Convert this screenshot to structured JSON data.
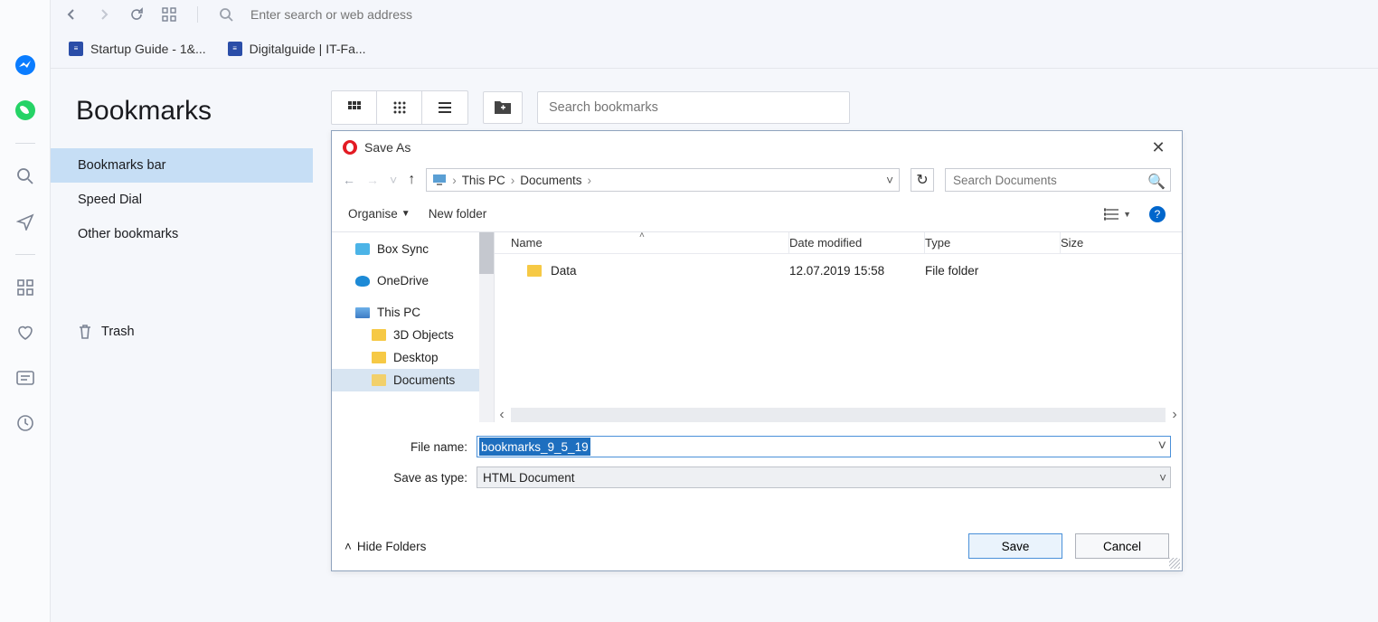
{
  "topbar": {
    "search_placeholder": "Enter search or web address"
  },
  "tabs": [
    {
      "label": "Startup Guide - 1&..."
    },
    {
      "label": "Digitalguide | IT-Fa..."
    }
  ],
  "page_title": "Bookmarks",
  "sidebar": {
    "items": [
      "Bookmarks bar",
      "Speed Dial",
      "Other bookmarks"
    ],
    "trash": "Trash"
  },
  "search_bookmarks_placeholder": "Search bookmarks",
  "modal": {
    "title": "Save As",
    "crumbs": [
      "This PC",
      "Documents"
    ],
    "search_placeholder": "Search Documents",
    "organise": "Organise",
    "new_folder": "New folder",
    "columns": {
      "name": "Name",
      "date": "Date modified",
      "type": "Type",
      "size": "Size"
    },
    "rows": [
      {
        "name": "Data",
        "date": "12.07.2019 15:58",
        "type": "File folder"
      }
    ],
    "tree": [
      "Box Sync",
      "OneDrive",
      "This PC",
      "3D Objects",
      "Desktop",
      "Documents"
    ],
    "file_name_label": "File name:",
    "file_name_value": "bookmarks_9_5_19",
    "save_type_label": "Save as type:",
    "save_type_value": "HTML Document",
    "hide_folders": "Hide Folders",
    "save": "Save",
    "cancel": "Cancel"
  }
}
